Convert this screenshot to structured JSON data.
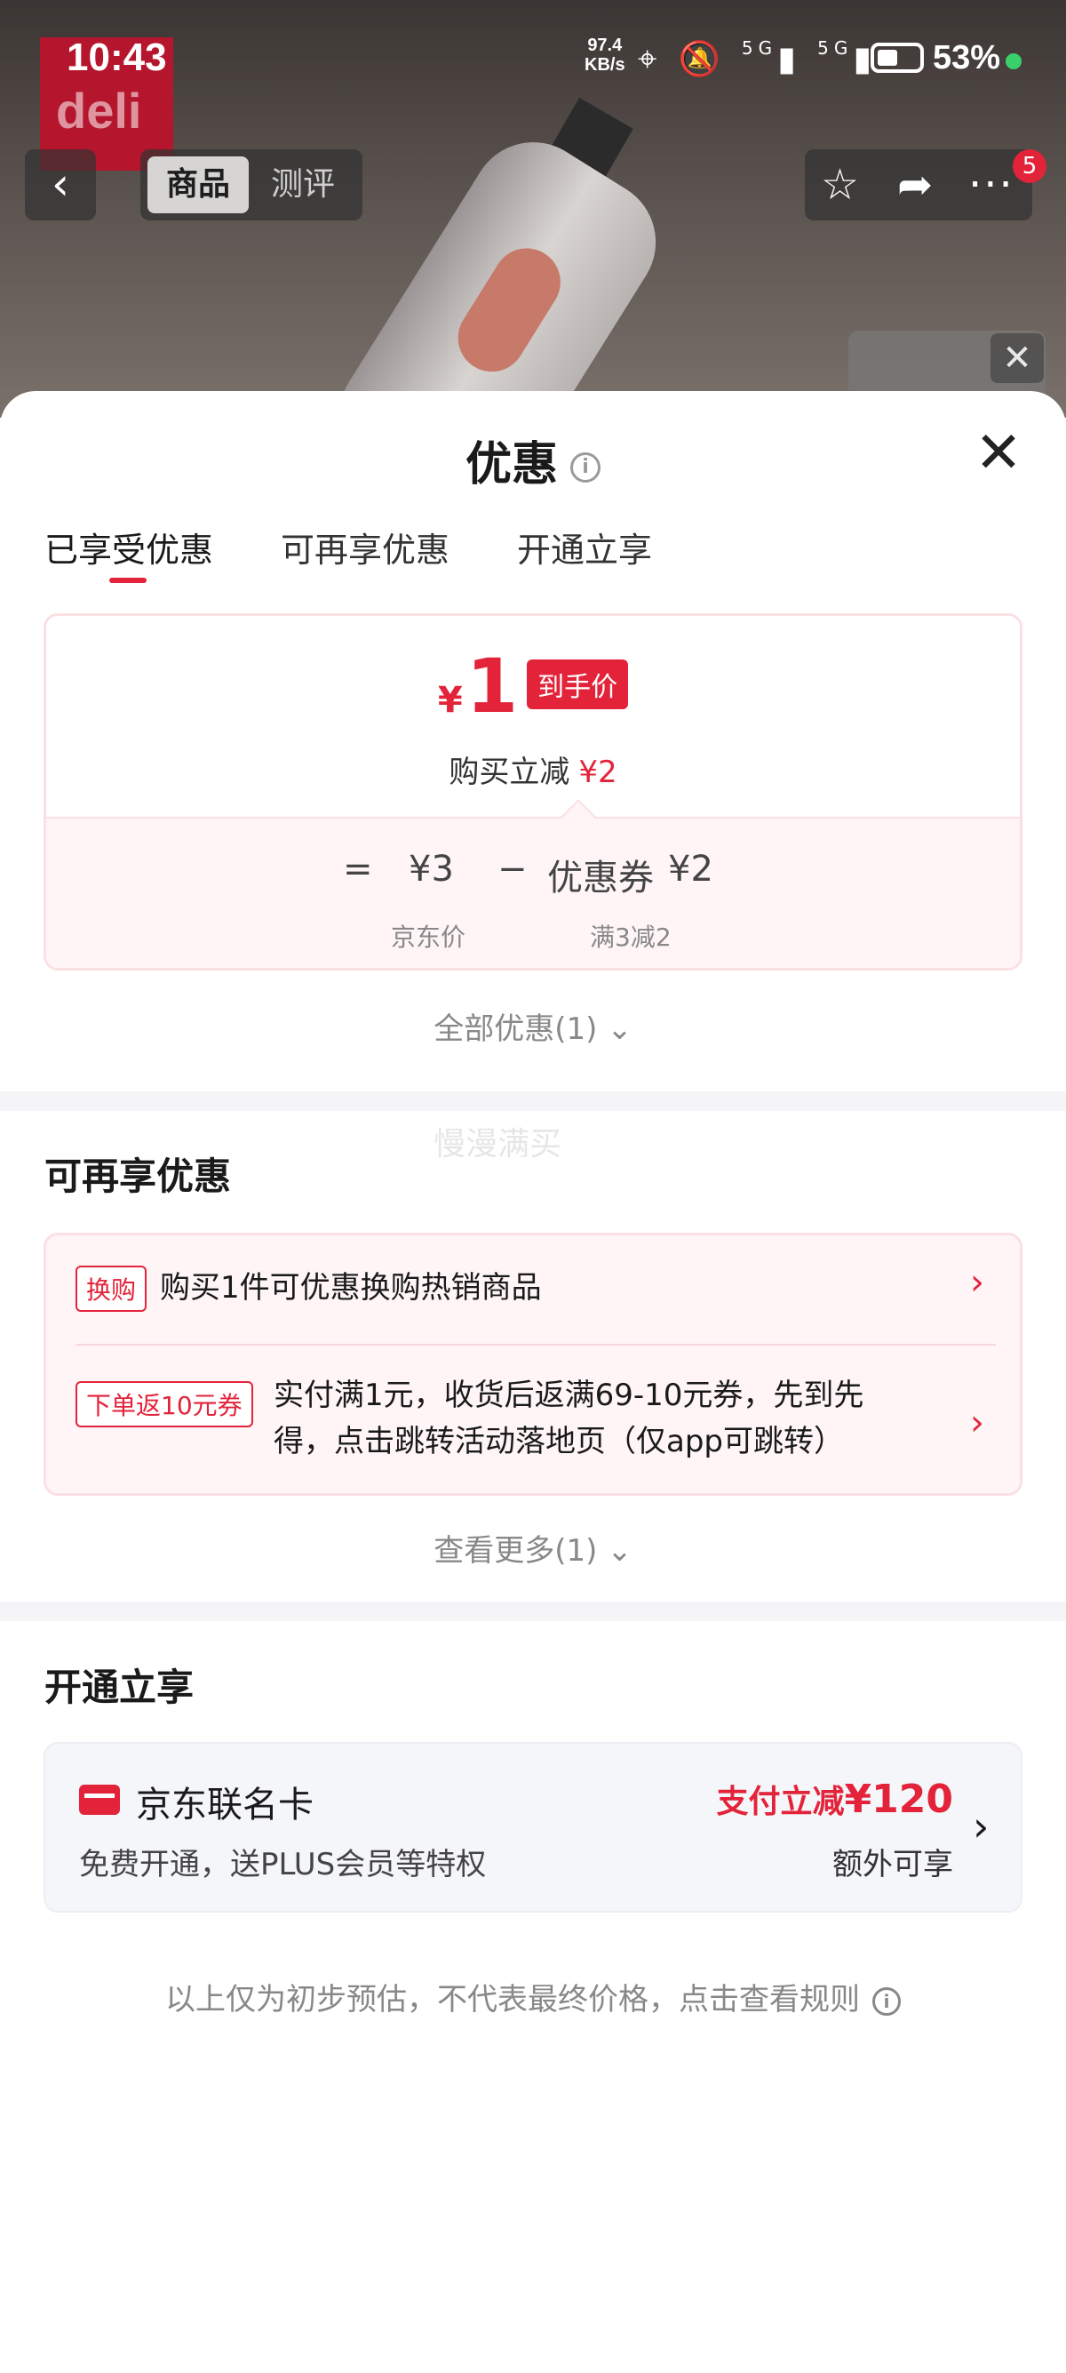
{
  "status_bar": {
    "time": "10:43",
    "net_speed_value": "97.4",
    "net_speed_unit": "KB/s",
    "signal_label_1": "5G",
    "signal_label_2": "5G",
    "battery": "53%",
    "battery_level": 0.53
  },
  "background": {
    "brand": "deli"
  },
  "nav": {
    "back_icon": "chevron-left-icon",
    "tabs": [
      "商品",
      "测评"
    ],
    "active_tab": "商品",
    "badge_count": "5"
  },
  "sheet": {
    "title": "优惠",
    "tabs": [
      "已享受优惠",
      "可再享优惠",
      "开通立享"
    ],
    "active_tab": "已享受优惠",
    "price_card": {
      "currency": "¥",
      "final_price": "1",
      "final_price_tag": "到手价",
      "reduce_label": "购买立减",
      "reduce_amount": "¥2",
      "eq": "=",
      "jd_price": "¥3",
      "minus": "−",
      "coupon_label": "优惠券",
      "coupon_amount": "¥2",
      "jd_price_label": "京东价",
      "coupon_rule": "满3减2"
    },
    "all_discounts_link": "全部优惠(1)",
    "watermark": "慢漫满买",
    "more_section": {
      "title": "可再享优惠",
      "offers": [
        {
          "tag": "换购",
          "text": "购买1件可优惠换购热销商品"
        },
        {
          "tag": "下单返10元券",
          "text_line1": "实付满1元，收货后返满69-10元券，先到先",
          "text_line2": "得，点击跳转活动落地页（仅app可跳转）"
        }
      ],
      "see_more_link": "查看更多(1)"
    },
    "open_section": {
      "title": "开通立享",
      "card_name": "京东联名卡",
      "card_desc": "免费开通，送PLUS会员等特权",
      "promo_prefix": "支付立减",
      "promo_amount": "¥120",
      "extra_note": "额外可享"
    },
    "footer_note": "以上仅为初步预估，不代表最终价格，点击查看规则"
  },
  "colors": {
    "accent_red": "#e3233a",
    "card_pink_bg": "#fff5f6",
    "muted_text": "#888888"
  }
}
